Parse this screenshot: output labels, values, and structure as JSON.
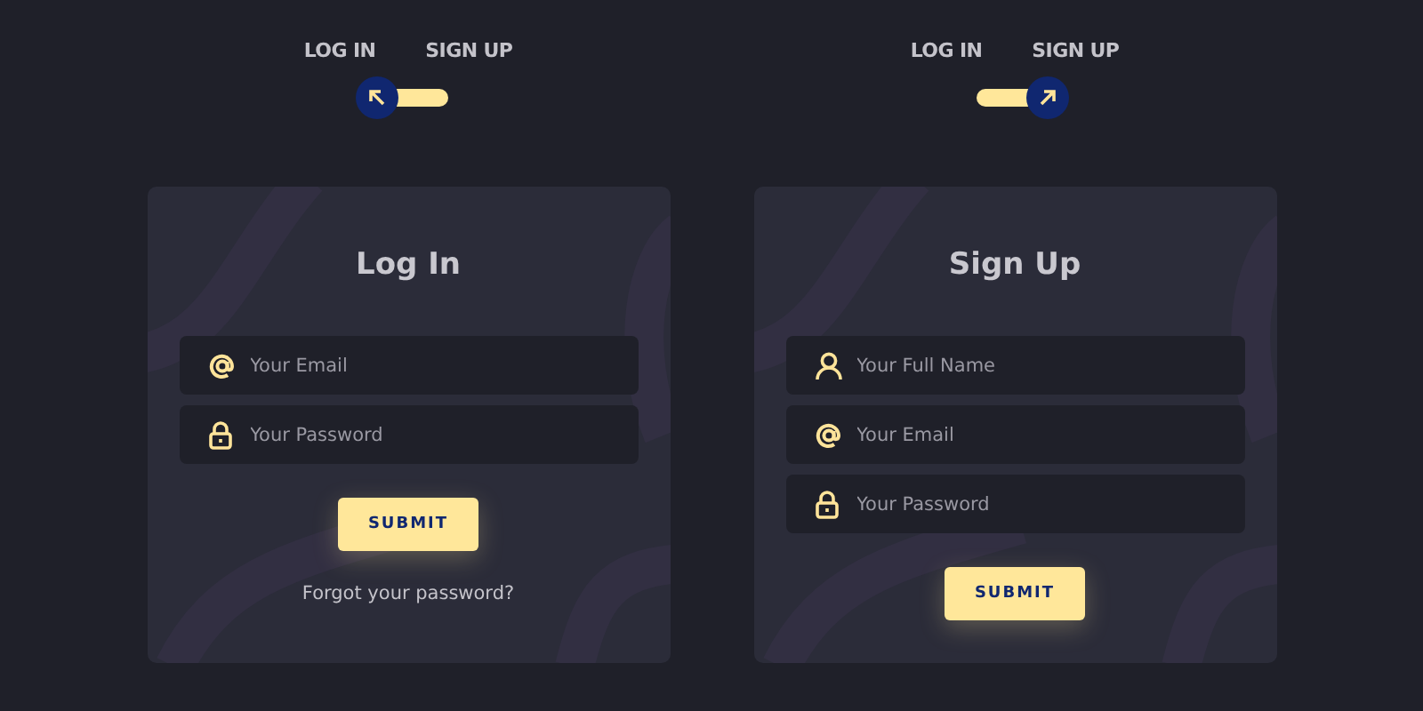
{
  "panels": [
    {
      "switch": {
        "labels": [
          "LOG IN",
          "SIGN UP"
        ],
        "checked": false
      },
      "card": {
        "title": "Log In",
        "fields": [
          {
            "kind": "at",
            "placeholder": "Your Email"
          },
          {
            "kind": "lock",
            "placeholder": "Your Password"
          }
        ],
        "button": "SUBMIT",
        "link": "Forgot your password?"
      }
    },
    {
      "switch": {
        "labels": [
          "LOG IN",
          "SIGN UP"
        ],
        "checked": true
      },
      "card": {
        "title": "Sign Up",
        "fields": [
          {
            "kind": "user",
            "placeholder": "Your Full Name"
          },
          {
            "kind": "at",
            "placeholder": "Your Email"
          },
          {
            "kind": "lock",
            "placeholder": "Your Password"
          }
        ],
        "button": "SUBMIT"
      }
    }
  ]
}
